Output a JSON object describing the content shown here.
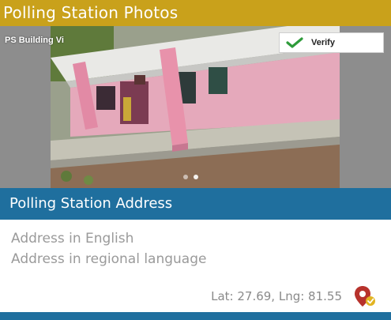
{
  "photos_section": {
    "title": "Polling Station Photos",
    "photo_label": "PS Building Vi",
    "verify_label": "Verify",
    "carousel": {
      "total": 2,
      "active_index": 1
    }
  },
  "address_section": {
    "title": "Polling Station Address",
    "address_english": "Address in English",
    "address_regional": "Address in regional language",
    "coordinates": "Lat: 27.69, Lng: 81.55"
  },
  "colors": {
    "photos_header_bg": "#c9a11b",
    "address_header_bg": "#1f6f9e",
    "verify_check": "#2e9b3a",
    "pin_red": "#b7322c",
    "pin_badge": "#e2b422"
  },
  "icons": {
    "verify": "check-icon",
    "location": "map-pin-icon"
  }
}
